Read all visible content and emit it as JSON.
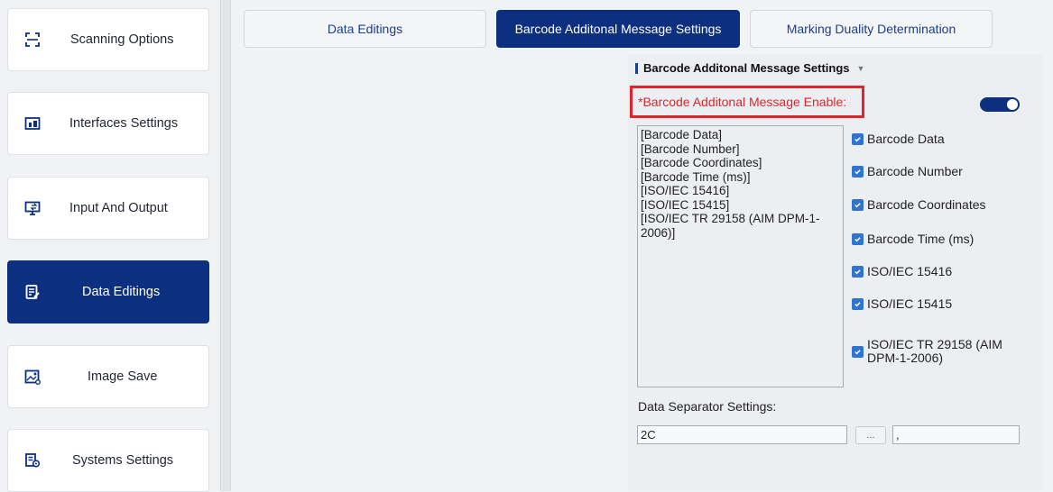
{
  "sidebar": {
    "items": [
      {
        "label": "Scanning Options",
        "icon": "scan-frame-icon",
        "active": false
      },
      {
        "label": "Interfaces Settings",
        "icon": "interface-devices-icon",
        "active": false
      },
      {
        "label": "Input And Output",
        "icon": "monitor-io-icon",
        "active": false
      },
      {
        "label": "Data Editings",
        "icon": "edit-document-icon",
        "active": true
      },
      {
        "label": "Image Save",
        "icon": "image-save-icon",
        "active": false
      },
      {
        "label": "Systems Settings",
        "icon": "system-settings-icon",
        "active": false
      }
    ]
  },
  "tabs": [
    {
      "label": "Data Editings",
      "active": false
    },
    {
      "label": "Barcode Additonal Message Settings",
      "active": true
    },
    {
      "label": "Marking Duality Determination",
      "active": false
    }
  ],
  "section": {
    "title": "Barcode Additonal Message Settings",
    "enable_label": "*Barcode Additonal Message Enable:",
    "enable_on": true
  },
  "listbox": {
    "lines": [
      "[Barcode Data]",
      "[Barcode Number]",
      "[Barcode Coordinates]",
      "[Barcode Time (ms)]",
      "[ISO/IEC 15416]",
      "[ISO/IEC 15415]",
      "[ISO/IEC TR 29158 (AIM DPM-1-2006)]"
    ]
  },
  "checkboxes": [
    {
      "label": "Barcode Data",
      "checked": true
    },
    {
      "label": "Barcode Number",
      "checked": true
    },
    {
      "label": "Barcode Coordinates",
      "checked": true
    },
    {
      "label": "Barcode Time (ms)",
      "checked": true
    },
    {
      "label": "ISO/IEC 15416",
      "checked": true
    },
    {
      "label": "ISO/IEC 15415",
      "checked": true
    },
    {
      "label": "ISO/IEC TR 29158 (AIM DPM-1-2006)",
      "checked": true
    }
  ],
  "separator": {
    "label": "Data Separator Settings:",
    "hex_value": "2C",
    "button_label": "...",
    "char_value": ","
  },
  "colors": {
    "accent": "#0d2f80",
    "highlight": "#e0262b",
    "checkbox": "#2f74d0"
  }
}
